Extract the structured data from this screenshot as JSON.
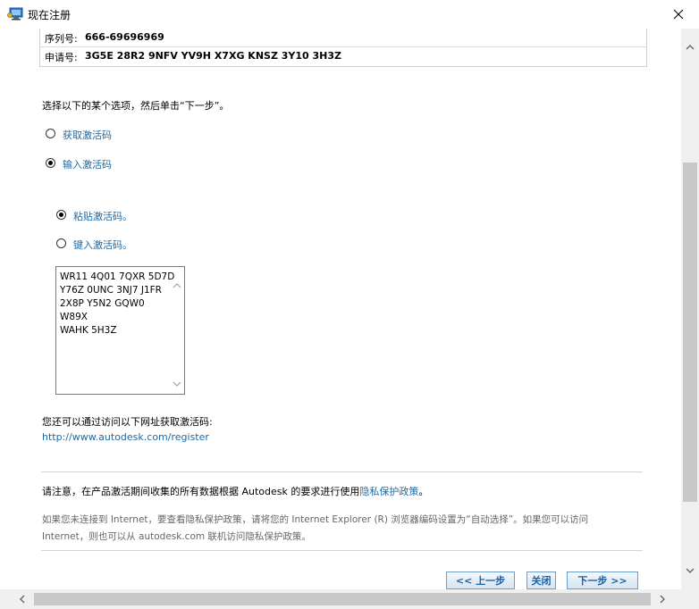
{
  "window": {
    "title": "现在注册",
    "close_icon": "close-icon",
    "app_icon": "monitor-key-icon"
  },
  "info": {
    "serial_label": "序列号:",
    "serial_value": "666-69696969",
    "request_label": "申请号:",
    "request_value": "3G5E 28R2 9NFV YV9H X7XG KNSZ 3Y10 3H3Z"
  },
  "instruction": "选择以下的某个选项，然后单击“下一步”。",
  "options": {
    "get_code": {
      "label": "获取激活码",
      "selected": false
    },
    "enter_code": {
      "label": "输入激活码",
      "selected": true
    }
  },
  "sub_options": {
    "paste": {
      "label": "粘贴激活码。",
      "selected": true
    },
    "type": {
      "label": "键入激活码。",
      "selected": false
    }
  },
  "activation_code_lines": [
    "WR11 4Q01 7QXR 5D7D",
    "Y76Z 0UNC 3NJ7 J1FR",
    "2X8P Y5N2 GQW0",
    "W89X",
    "WAHK 5H3Z"
  ],
  "alt_access_text": "您还可以通过访问以下网址获取激活码:",
  "register_url": "http://www.autodesk.com/register",
  "notice": {
    "text": "请注意，在产品激活期间收集的所有数据根据 Autodesk 的要求进行使用",
    "link": "隐私保护政策",
    "period": "。"
  },
  "internet_note": {
    "line1": "如果您未连接到 Internet，要查看隐私保护政策，请将您的 Internet Explorer (R) 浏览器编码设置为“自动选择”。如果您可以访问",
    "line2": "Internet，则也可以从 autodesk.com 联机访问隐私保护政策。"
  },
  "buttons": {
    "back": "<< 上一步",
    "close": "关闭",
    "next": "下一步 >>"
  },
  "colors": {
    "link": "#1a6aa6",
    "button_text": "#1b5fa0",
    "scrollbar": "#c8c8c8"
  }
}
